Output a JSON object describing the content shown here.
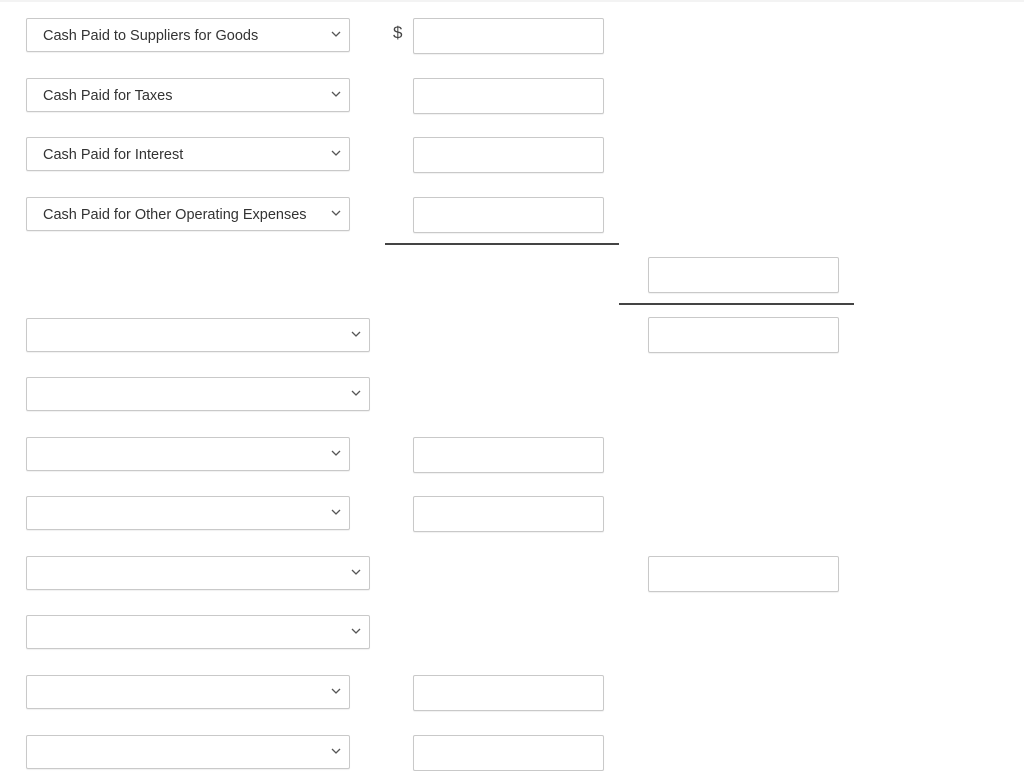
{
  "currency_symbol": "$",
  "rows": [
    {
      "select_value": "Cash Paid to Suppliers for Goods"
    },
    {
      "select_value": "Cash Paid for Taxes"
    },
    {
      "select_value": "Cash Paid for Interest"
    },
    {
      "select_value": "Cash Paid for Other Operating Expenses"
    },
    {
      "select_value": ""
    },
    {
      "select_value": ""
    },
    {
      "select_value": ""
    },
    {
      "select_value": ""
    },
    {
      "select_value": ""
    },
    {
      "select_value": ""
    },
    {
      "select_value": ""
    },
    {
      "select_value": ""
    }
  ]
}
